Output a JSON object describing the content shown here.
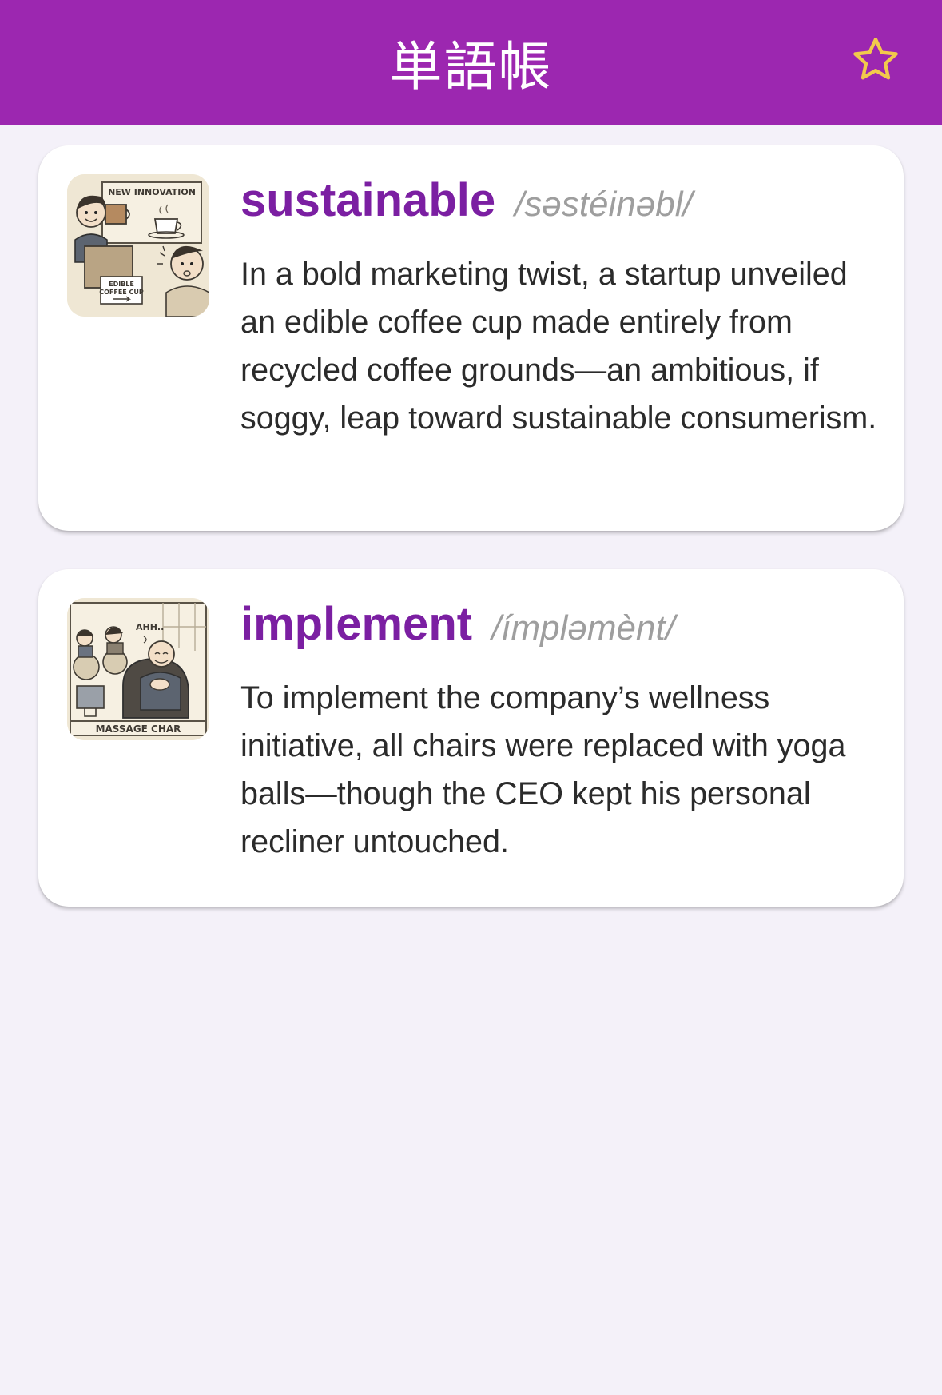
{
  "header": {
    "title": "単語帳",
    "favorite_icon": "star-outline-icon",
    "bar_color": "#9c27b0",
    "star_color": "#f2c94c"
  },
  "cards": [
    {
      "word": "sustainable",
      "pronunciation": "/səstéinəbl/",
      "sentence": "In a bold marketing twist, a startup unveiled an edible coffee cup made entirely from recycled coffee grounds—an ambitious, if soggy, leap toward sustainable consumerism.",
      "image": {
        "sign_text": "NEW INNOVATION",
        "placard_line1": "EDIBLE",
        "placard_line2": "COFFEE CUP"
      }
    },
    {
      "word": "implement",
      "pronunciation": "/ímpləmènt/",
      "sentence": "To implement the company’s wellness initiative, all chairs were replaced with yoga balls—though the CEO kept his personal recliner untouched.",
      "image": {
        "speech_text": "AHH..",
        "caption_text": "MASSAGE CHAR"
      }
    }
  ],
  "colors": {
    "word": "#7b1fa2",
    "pronunciation": "#9e9e9e",
    "background": "#f4f1f9"
  }
}
